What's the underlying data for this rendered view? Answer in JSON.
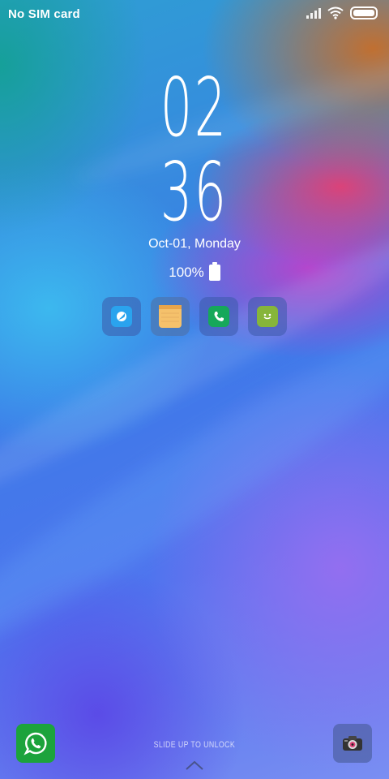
{
  "status_bar": {
    "carrier": "No SIM card",
    "icons": [
      "signal-icon",
      "wifi-icon",
      "battery-icon"
    ],
    "battery_level": 1.0
  },
  "clock": {
    "hour": "02",
    "minute": "36"
  },
  "date_text": "Oct-01, Monday",
  "battery": {
    "percent_text": "100%",
    "icon": "battery-full-icon"
  },
  "shortcuts": [
    {
      "name": "browser-icon"
    },
    {
      "name": "notes-icon"
    },
    {
      "name": "phone-icon"
    },
    {
      "name": "messages-icon"
    }
  ],
  "unlock": {
    "text": "SLIDE UP TO UNLOCK",
    "icon": "chevron-up-icon"
  },
  "bottom_left": {
    "icon": "whatsapp-icon",
    "color": "#1ca33c"
  },
  "bottom_right": {
    "icon": "camera-icon"
  }
}
